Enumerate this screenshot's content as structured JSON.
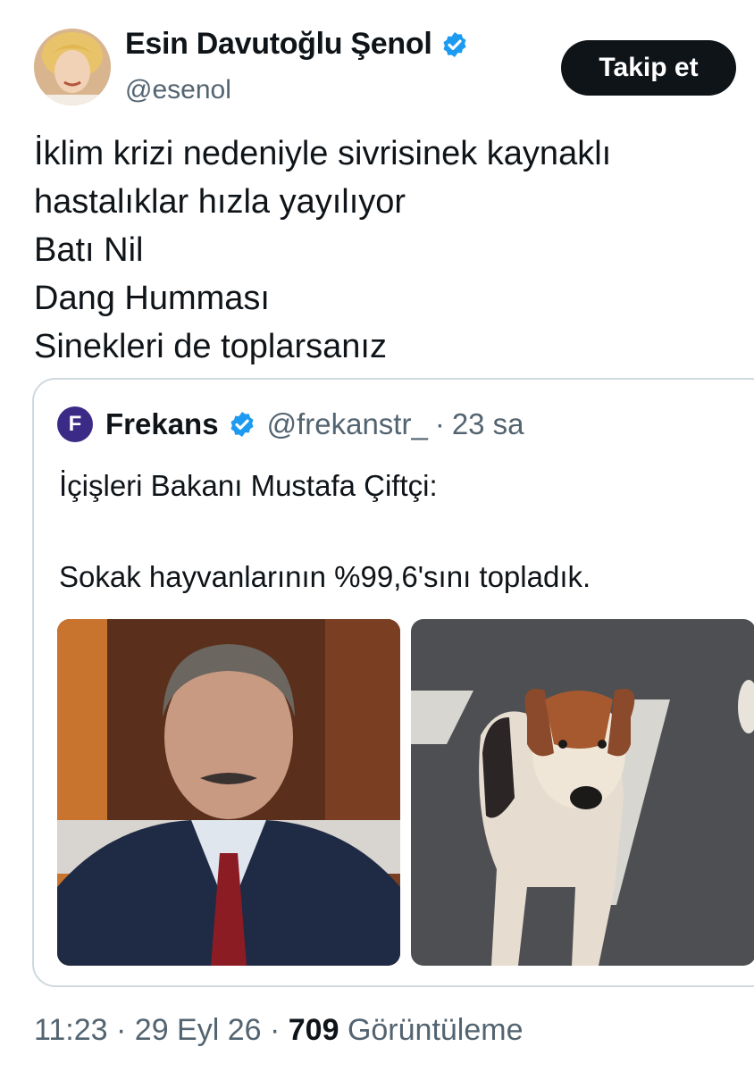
{
  "author": {
    "name": "Esin Davutoğlu Şenol",
    "handle": "@esenol",
    "verified_color": "#1d9bf0",
    "avatar_icon": "profile-photo"
  },
  "follow_button": {
    "label": "Takip et"
  },
  "tweet": {
    "lines": [
      "İklim krizi nedeniyle sivrisinek kaynaklı",
      "hastalıklar hızla yayılıyor",
      "Batı Nil",
      "Dang Humması",
      "Sinekleri de toplarsanız"
    ]
  },
  "quoted": {
    "logo_letter": "F",
    "name": "Frekans",
    "handle": "@frekanstr_",
    "separator": "·",
    "time": "23 sa",
    "text_line1": "İçişleri Bakanı Mustafa Çiftçi:",
    "text_line2": "Sokak hayvanlarının %99,6'sını topladık.",
    "photos": [
      "man-in-suit-photo",
      "street-dog-photo"
    ]
  },
  "meta": {
    "time": "11:23",
    "sep1": " · ",
    "date": "29 Eyl 26",
    "sep2": " · ",
    "views": "709",
    "views_label": " Görüntüleme"
  }
}
